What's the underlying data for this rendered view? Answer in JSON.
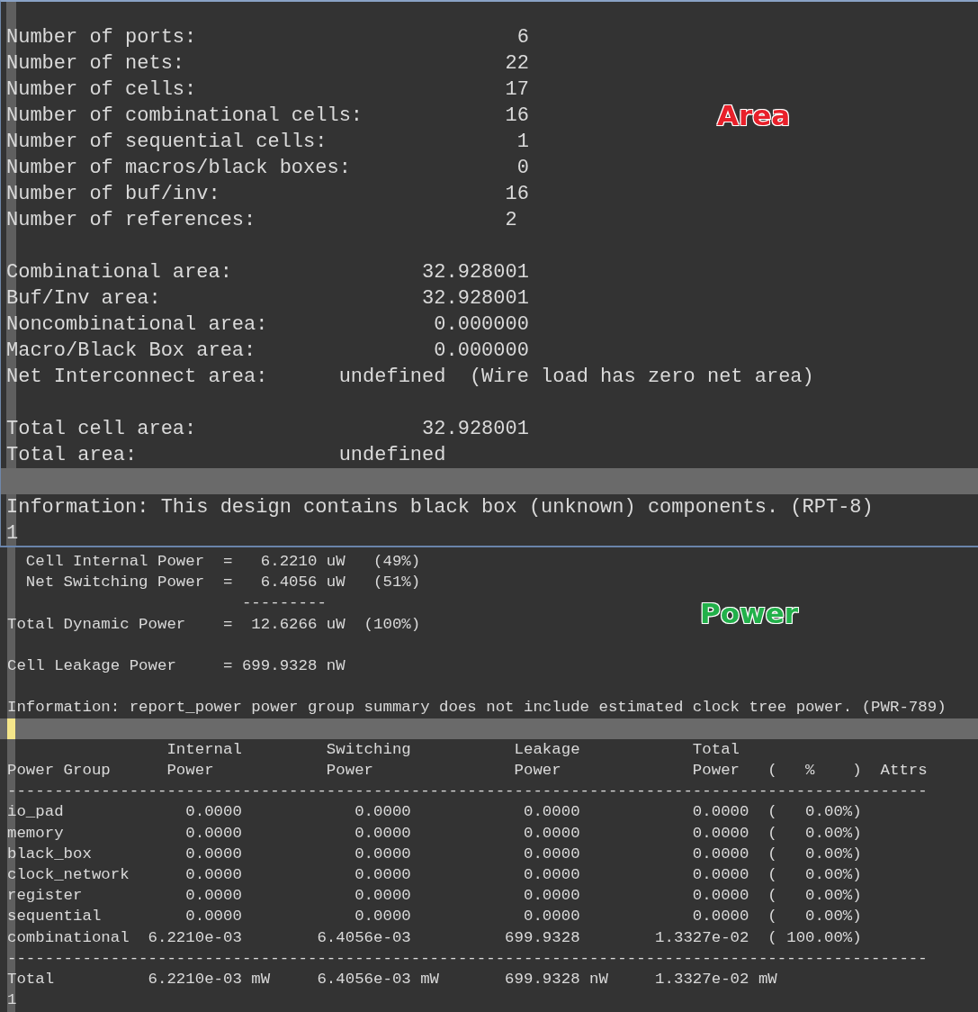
{
  "area_panel": {
    "annotation": {
      "text": "Area",
      "color": "#e8202a"
    },
    "lines": [
      {
        "kind": "text",
        "text": "Number of ports:                           6"
      },
      {
        "kind": "text",
        "text": "Number of nets:                           22"
      },
      {
        "kind": "text",
        "text": "Number of cells:                          17"
      },
      {
        "kind": "text",
        "text": "Number of combinational cells:            16"
      },
      {
        "kind": "text",
        "text": "Number of sequential cells:                1"
      },
      {
        "kind": "text",
        "text": "Number of macros/black boxes:              0"
      },
      {
        "kind": "text",
        "text": "Number of buf/inv:                        16"
      },
      {
        "kind": "text",
        "text": "Number of references:                     2"
      },
      {
        "kind": "blank"
      },
      {
        "kind": "text",
        "text": "Combinational area:                32.928001"
      },
      {
        "kind": "text",
        "text": "Buf/Inv area:                      32.928001"
      },
      {
        "kind": "text",
        "text": "Noncombinational area:              0.000000"
      },
      {
        "kind": "text",
        "text": "Macro/Black Box area:               0.000000"
      },
      {
        "kind": "text",
        "text": "Net Interconnect area:      undefined  (Wire load has zero net area)"
      },
      {
        "kind": "blank"
      },
      {
        "kind": "text",
        "text": "Total cell area:                   32.928001"
      },
      {
        "kind": "text",
        "text": "Total area:                 undefined"
      },
      {
        "kind": "highlight"
      },
      {
        "kind": "text",
        "text": "Information: This design contains black box (unknown) components. (RPT-8)"
      },
      {
        "kind": "text",
        "text": "1"
      }
    ]
  },
  "power_panel": {
    "annotation": {
      "text": "Power",
      "color": "#22b04a"
    },
    "lines": [
      {
        "kind": "text",
        "text": "  Cell Internal Power  =   6.2210 uW   (49%)"
      },
      {
        "kind": "text",
        "text": "  Net Switching Power  =   6.4056 uW   (51%)"
      },
      {
        "kind": "text",
        "text": "                         ---------"
      },
      {
        "kind": "text",
        "text": "Total Dynamic Power    =  12.6266 uW  (100%)"
      },
      {
        "kind": "blank"
      },
      {
        "kind": "text",
        "text": "Cell Leakage Power     = 699.9328 nW"
      },
      {
        "kind": "blank"
      },
      {
        "kind": "text",
        "text": "Information: report_power power group summary does not include estimated clock tree power. (PWR-789)"
      },
      {
        "kind": "cursor"
      },
      {
        "kind": "text",
        "text": "                 Internal         Switching           Leakage            Total"
      },
      {
        "kind": "text",
        "text": "Power Group      Power            Power               Power              Power   (   %    )  Attrs"
      },
      {
        "kind": "text",
        "text": "--------------------------------------------------------------------------------------------------"
      },
      {
        "kind": "text",
        "text": "io_pad             0.0000            0.0000            0.0000            0.0000  (   0.00%)"
      },
      {
        "kind": "text",
        "text": "memory             0.0000            0.0000            0.0000            0.0000  (   0.00%)"
      },
      {
        "kind": "text",
        "text": "black_box          0.0000            0.0000            0.0000            0.0000  (   0.00%)"
      },
      {
        "kind": "text",
        "text": "clock_network      0.0000            0.0000            0.0000            0.0000  (   0.00%)"
      },
      {
        "kind": "text",
        "text": "register           0.0000            0.0000            0.0000            0.0000  (   0.00%)"
      },
      {
        "kind": "text",
        "text": "sequential         0.0000            0.0000            0.0000            0.0000  (   0.00%)"
      },
      {
        "kind": "text",
        "text": "combinational  6.2210e-03        6.4056e-03          699.9328        1.3327e-02  ( 100.00%)"
      },
      {
        "kind": "text",
        "text": "--------------------------------------------------------------------------------------------------"
      },
      {
        "kind": "text",
        "text": "Total          6.2210e-03 mW     6.4056e-03 mW       699.9328 nW     1.3327e-02 mW"
      },
      {
        "kind": "text",
        "text": "1"
      }
    ]
  }
}
